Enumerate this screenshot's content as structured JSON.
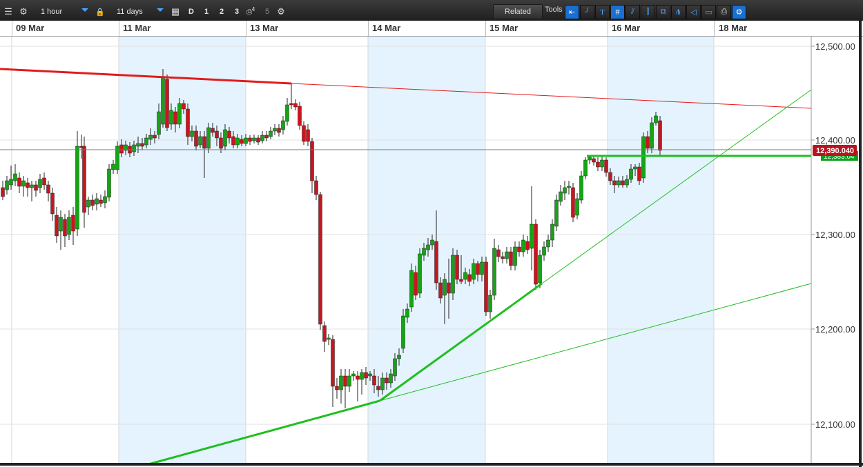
{
  "toolbar": {
    "interval": "1 hour",
    "range": "11 days",
    "periods": [
      "D",
      "1",
      "2",
      "3",
      "4",
      "5"
    ],
    "related_label": "Related",
    "tools_label": "Tools",
    "icons": [
      "menu-icon",
      "gear-icon",
      "lock-icon",
      "calendar-icon",
      "compare-icon",
      "settings-icon",
      "arrow-left-icon",
      "curve-icon",
      "text-icon",
      "hash-icon",
      "trendline-icon",
      "candle-icon",
      "copy-icon",
      "fibonacci-icon",
      "shape-icon",
      "eraser-icon",
      "print-icon",
      "tools-settings-icon"
    ]
  },
  "date_axis": {
    "labels": [
      "09 Mar",
      "11 Mar",
      "13 Mar",
      "14 Mar",
      "15 Mar",
      "16 Mar",
      "18 Mar"
    ]
  },
  "price_axis": {
    "labels": [
      "12,500.00",
      "12,400.00",
      "12,300.00",
      "12,200.00",
      "12,100.00"
    ],
    "current_price": "12,390.040",
    "current_price_color": "#b8141f",
    "secondary_price": "12,383.04",
    "secondary_price_color": "#0aa01c"
  },
  "colors": {
    "up": "#16a316",
    "down": "#c8161f",
    "shade": "#e4f3fd",
    "resistance": "#e31b1b",
    "support": "#1fbf1f"
  }
}
